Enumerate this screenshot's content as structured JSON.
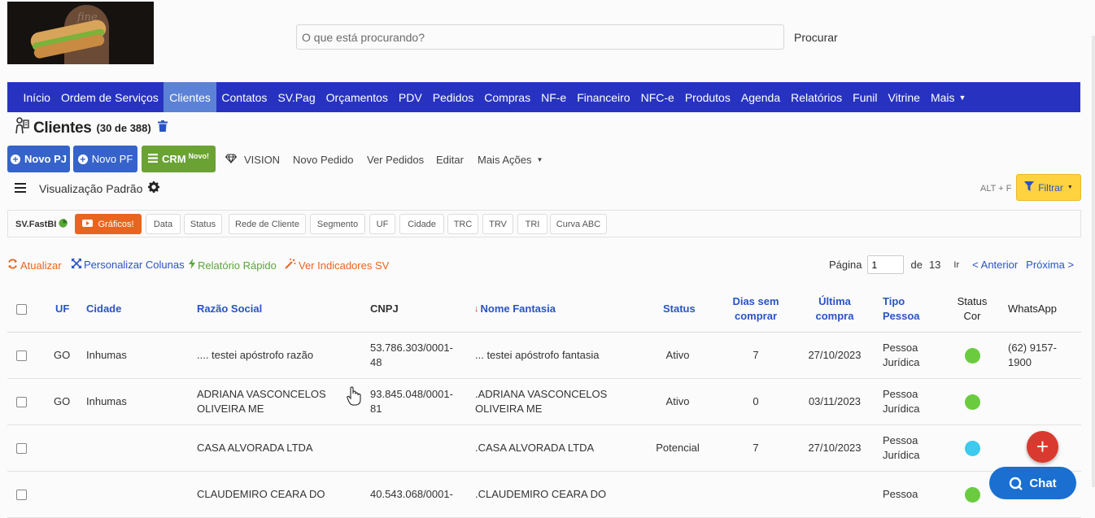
{
  "header": {
    "search_placeholder": "O que está procurando?",
    "search_button": "Procurar",
    "logo_watermark": "fine"
  },
  "nav": {
    "items": [
      "Início",
      "Ordem de Serviços",
      "Clientes",
      "Contatos",
      "SV.Pag",
      "Orçamentos",
      "PDV",
      "Pedidos",
      "Compras",
      "NF-e",
      "Financeiro",
      "NFC-e",
      "Produtos",
      "Agenda",
      "Relatórios",
      "Funil",
      "Vitrine"
    ],
    "more_label": "Mais",
    "active": "Clientes"
  },
  "page": {
    "title": "Clientes",
    "count": "(30 de 388)"
  },
  "actions": {
    "novo_pj": "Novo PJ",
    "novo_pf": "Novo PF",
    "crm": "CRM",
    "crm_badge": "Novo!",
    "vision": "VISION",
    "novo_pedido": "Novo Pedido",
    "ver_pedidos": "Ver Pedidos",
    "editar": "Editar",
    "mais_acoes": "Mais Ações"
  },
  "view": {
    "label": "Visualização Padrão",
    "shortcut": "ALT + F",
    "filter_label": "Filtrar"
  },
  "fastbi": {
    "label": "SV.FastBI",
    "graficos": "Gráficos!",
    "chips": [
      "Data",
      "Status",
      "Rede de Cliente",
      "Segmento",
      "UF",
      "Cidade",
      "TRC",
      "TRV",
      "TRI",
      "Curva ABC"
    ]
  },
  "toolbar": {
    "atualizar": "Atualizar",
    "personalizar": "Personalizar Colunas",
    "relatorio": "Relatório Rápido",
    "indicadores": "Ver Indicadores SV"
  },
  "pager": {
    "page_label": "Página",
    "current": "1",
    "of_label": "de",
    "total": "13",
    "go": "Ir",
    "prev": "< Anterior",
    "next": "Próxima >"
  },
  "table": {
    "headers": {
      "uf": "UF",
      "cidade": "Cidade",
      "razao": "Razão Social",
      "cnpj": "CNPJ",
      "fantasia": "Nome Fantasia",
      "status": "Status",
      "dias_1": "Dias sem",
      "dias_2": "comprar",
      "ultima_1": "Última",
      "ultima_2": "compra",
      "tipo_1": "Tipo",
      "tipo_2": "Pessoa",
      "cor_1": "Status",
      "cor_2": "Cor",
      "whatsapp": "WhatsApp"
    },
    "rows": [
      {
        "uf": "GO",
        "cidade": "Inhumas",
        "razao_1": ".... testei apóstrofo razão",
        "razao_2": "",
        "cnpj_1": "53.786.303/0001-",
        "cnpj_2": "48",
        "fantasia_1": "... testei apóstrofo fantasia",
        "fantasia_2": "",
        "status": "Ativo",
        "dias": "7",
        "ultima": "27/10/2023",
        "tipo_1": "Pessoa",
        "tipo_2": "Jurídica",
        "color": "#6bcb3f",
        "wa_1": "(62) 9157-",
        "wa_2": "1900"
      },
      {
        "uf": "GO",
        "cidade": "Inhumas",
        "razao_1": "ADRIANA VASCONCELOS",
        "razao_2": "OLIVEIRA ME",
        "cnpj_1": "93.845.048/0001-",
        "cnpj_2": "81",
        "fantasia_1": ".ADRIANA VASCONCELOS",
        "fantasia_2": "OLIVEIRA ME",
        "status": "Ativo",
        "dias": "0",
        "ultima": "03/11/2023",
        "tipo_1": "Pessoa",
        "tipo_2": "Jurídica",
        "color": "#6bcb3f",
        "wa_1": "",
        "wa_2": ""
      },
      {
        "uf": "",
        "cidade": "",
        "razao_1": "CASA ALVORADA LTDA",
        "razao_2": "",
        "cnpj_1": "",
        "cnpj_2": "",
        "fantasia_1": ".CASA ALVORADA LTDA",
        "fantasia_2": "",
        "status": "Potencial",
        "dias": "7",
        "ultima": "27/10/2023",
        "tipo_1": "Pessoa",
        "tipo_2": "Jurídica",
        "color": "#3ec9ee",
        "wa_1": "",
        "wa_2": ""
      },
      {
        "uf": "",
        "cidade": "",
        "razao_1": "CLAUDEMIRO CEARA DO",
        "razao_2": "",
        "cnpj_1": "40.543.068/0001-",
        "cnpj_2": "",
        "fantasia_1": ".CLAUDEMIRO CEARA DO",
        "fantasia_2": "",
        "status": "",
        "dias": "",
        "ultima": "",
        "tipo_1": "Pessoa",
        "tipo_2": "",
        "color": "#6bcb3f",
        "wa_1": "",
        "wa_2": ""
      }
    ]
  },
  "chat_label": "Chat",
  "fab_symbol": "+"
}
